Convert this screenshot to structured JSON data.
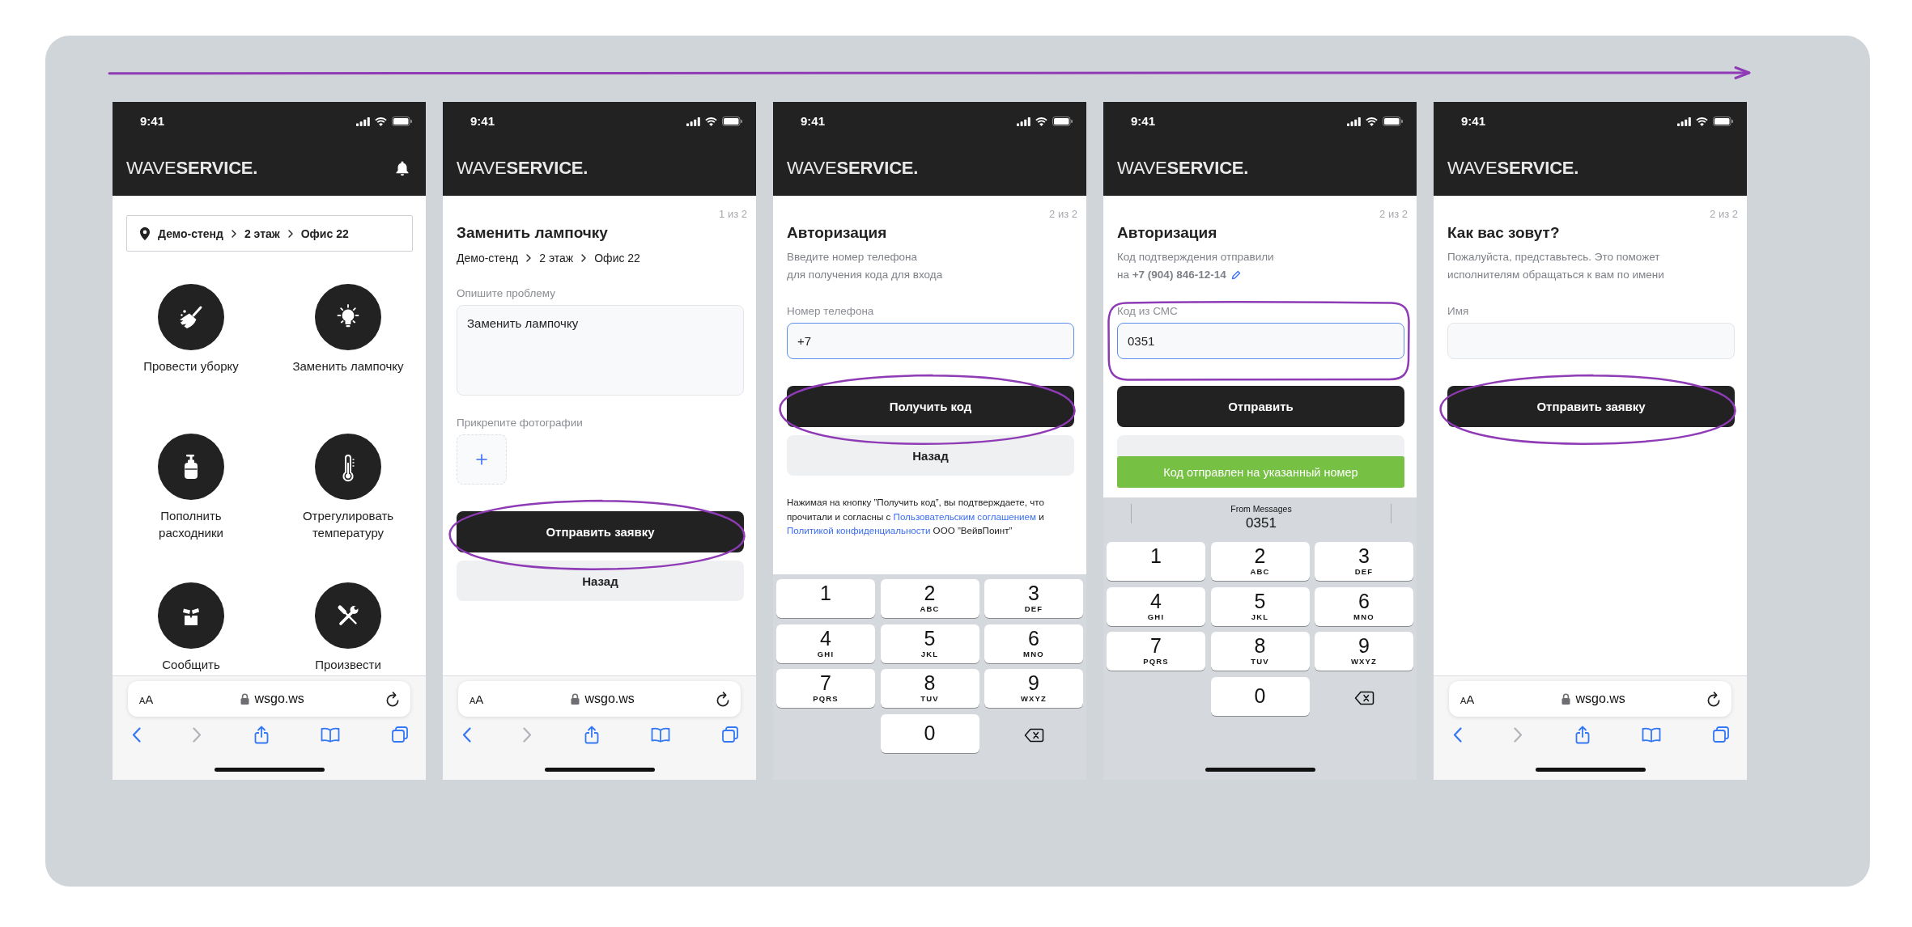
{
  "screens": [
    {
      "kind": "home",
      "status_bar": {
        "time": "9:41"
      },
      "header": {
        "logo": "WAVE**SERVICE.**",
        "bell": true
      },
      "location": [
        "Демо-стенд",
        "2 этаж",
        "Офис 22"
      ],
      "services": [
        {
          "kind": "cleaning",
          "label": "Провести уборку"
        },
        {
          "kind": "lighting",
          "label": "Заменить лампочку"
        },
        {
          "kind": "supplies",
          "label": "Пополнить расходники"
        },
        {
          "kind": "climate",
          "label": "Отрегулировать температуру"
        },
        {
          "kind": "fault",
          "label": "Сообщить"
        },
        {
          "kind": "repair",
          "label": "Произвести"
        }
      ],
      "browser_bar": {
        "format_button": "AA",
        "url": "wsgo.ws",
        "back_enabled": true,
        "forward_enabled": false
      },
      "home_indicator": true
    },
    {
      "kind": "form",
      "status_bar": {
        "time": "9:41"
      },
      "header": {
        "logo": "WAVE**SERVICE.**",
        "bell": false
      },
      "step": "1 из 2",
      "title": "Заменить лампочку",
      "breadcrumb": [
        "Демо-стенд",
        "2 этаж",
        "Офис 22"
      ],
      "fields": [
        {
          "kind": "textarea",
          "label": "Опишите проблему",
          "value": "Заменить лампочку",
          "focused": false,
          "highlighted": false
        },
        {
          "kind": "photos",
          "label": "Прикрепите фотографии"
        }
      ],
      "buttons": [
        {
          "kind": "primary",
          "label": "Отправить заявку",
          "highlighted": true
        },
        {
          "kind": "secondary",
          "label": "Назад",
          "highlighted": false
        }
      ],
      "browser_bar": {
        "format_button": "AA",
        "url": "wsgo.ws",
        "back_enabled": true,
        "forward_enabled": false
      },
      "home_indicator": true
    },
    {
      "kind": "form",
      "status_bar": {
        "time": "9:41"
      },
      "header": {
        "logo": "WAVE**SERVICE.**",
        "bell": false
      },
      "step": "2 из 2",
      "title": "Авторизация",
      "subtitle": "Введите номер телефона\nдля получения кода для входа",
      "fields": [
        {
          "kind": "input",
          "label": "Номер телефона",
          "value": "+7",
          "focused": true,
          "highlighted": false
        }
      ],
      "buttons": [
        {
          "kind": "primary",
          "label": "Получить код",
          "highlighted": true
        },
        {
          "kind": "secondary",
          "label": "Назад",
          "highlighted": false
        }
      ],
      "legal": [
        {
          "text": "Нажимая на кнопку ”Получить код”, вы подтверждаете, что прочитали и согласны с ",
          "link": false
        },
        {
          "text": "Пользовательским соглашением",
          "link": true
        },
        {
          "text": " и ",
          "link": false
        },
        {
          "text": "Политикой конфиденциальности",
          "link": true
        },
        {
          "text": " ООО ”ВейвПоинт”",
          "link": false
        }
      ],
      "keyboard": {
        "keys": [
          {
            "kind": "digit",
            "digit": "1"
          },
          {
            "kind": "digit",
            "digit": "2",
            "letters": "ABC"
          },
          {
            "kind": "digit",
            "digit": "3",
            "letters": "DEF"
          },
          {
            "kind": "digit",
            "digit": "4",
            "letters": "GHI"
          },
          {
            "kind": "digit",
            "digit": "5",
            "letters": "JKL"
          },
          {
            "kind": "digit",
            "digit": "6",
            "letters": "MNO"
          },
          {
            "kind": "digit",
            "digit": "7",
            "letters": "PQRS"
          },
          {
            "kind": "digit",
            "digit": "8",
            "letters": "TUV"
          },
          {
            "kind": "digit",
            "digit": "9",
            "letters": "WXYZ"
          },
          {
            "kind": "digit",
            "digit": "0"
          },
          {
            "kind": "delete"
          }
        ]
      },
      "home_indicator": false
    },
    {
      "kind": "form",
      "status_bar": {
        "time": "9:41"
      },
      "header": {
        "logo": "WAVE**SERVICE.**",
        "bell": false
      },
      "step": "2 из 2",
      "title": "Авторизация",
      "subtitle": "Код подтверждения отправили",
      "recipient": {
        "text": "на **+7 (904) 846-12-14**",
        "editable": true
      },
      "fields": [
        {
          "kind": "input",
          "label": "Код из СМС",
          "value": "0351",
          "focused": true,
          "highlighted": true
        }
      ],
      "buttons": [
        {
          "kind": "primary",
          "label": "Отправить",
          "highlighted": false
        },
        {
          "kind": "secondary",
          "highlighted": false
        }
      ],
      "toast": {
        "text": "Код отправлен на указанный номер"
      },
      "keyboard": {
        "suggestion": {
          "source": "From Messages",
          "value": "0351"
        },
        "keys": [
          {
            "kind": "digit",
            "digit": "1"
          },
          {
            "kind": "digit",
            "digit": "2",
            "letters": "ABC"
          },
          {
            "kind": "digit",
            "digit": "3",
            "letters": "DEF"
          },
          {
            "kind": "digit",
            "digit": "4",
            "letters": "GHI"
          },
          {
            "kind": "digit",
            "digit": "5",
            "letters": "JKL"
          },
          {
            "kind": "digit",
            "digit": "6",
            "letters": "MNO"
          },
          {
            "kind": "digit",
            "digit": "7",
            "letters": "PQRS"
          },
          {
            "kind": "digit",
            "digit": "8",
            "letters": "TUV"
          },
          {
            "kind": "digit",
            "digit": "9",
            "letters": "WXYZ"
          },
          {
            "kind": "digit",
            "digit": "0"
          },
          {
            "kind": "delete"
          }
        ]
      },
      "home_indicator": true
    },
    {
      "kind": "form",
      "status_bar": {
        "time": "9:41"
      },
      "header": {
        "logo": "WAVE**SERVICE.**",
        "bell": false
      },
      "step": "2 из 2",
      "title": "Как вас зовут?",
      "subtitle": "Пожалуйста, представьтесь. Это поможет\nисполнителям обращаться к вам по имени",
      "fields": [
        {
          "kind": "input",
          "label": "Имя",
          "focused": false,
          "highlighted": false
        }
      ],
      "buttons": [
        {
          "kind": "primary",
          "label": "Отправить заявку",
          "highlighted": true
        }
      ],
      "browser_bar": {
        "format_button": "AA",
        "url": "wsgo.ws",
        "back_enabled": true,
        "forward_enabled": false
      },
      "home_indicator": true
    }
  ]
}
